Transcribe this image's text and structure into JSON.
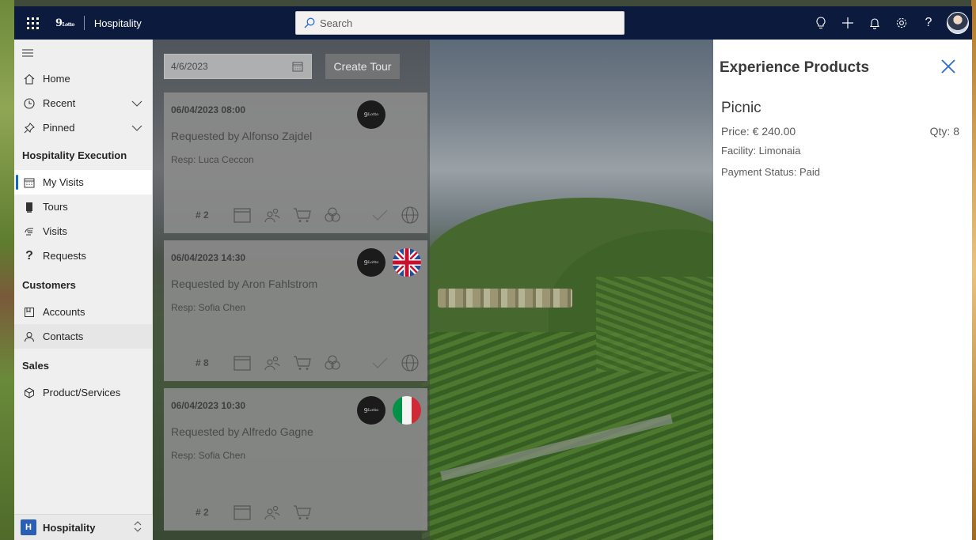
{
  "topbar": {
    "brand": "9",
    "brand_small": "Lotto",
    "app_name": "Hospitality",
    "search_placeholder": "Search",
    "icons": [
      "lightbulb-icon",
      "plus-icon",
      "bell-icon",
      "gear-icon",
      "help-icon"
    ],
    "help_label": "?"
  },
  "sidebar": {
    "home": "Home",
    "recent": "Recent",
    "pinned": "Pinned",
    "groups": {
      "execution": "Hospitality Execution",
      "customers": "Customers",
      "sales": "Sales"
    },
    "items": {
      "my_visits": "My Visits",
      "tours": "Tours",
      "visits": "Visits",
      "requests": "Requests",
      "accounts": "Accounts",
      "contacts": "Contacts",
      "product_services": "Product/Services"
    },
    "area": {
      "badge": "H",
      "label": "Hospitality"
    }
  },
  "toolbar": {
    "date_value": "4/6/2023",
    "create_tour_label": "Create Tour"
  },
  "cards": [
    {
      "datetime": "06/04/2023 08:00",
      "requested": "Requested by Alfonso Zajdel",
      "resp": "Resp: Luca Ceccon",
      "number": "# 2",
      "flag": "none"
    },
    {
      "datetime": "06/04/2023 14:30",
      "requested": "Requested by Aron Fahlstrom",
      "resp": "Resp: Sofia Chen",
      "number": "# 8",
      "flag": "uk"
    },
    {
      "datetime": "06/04/2023 10:30",
      "requested": "Requested by Alfredo Gagne",
      "resp": "Resp: Sofia Chen",
      "number": "# 2",
      "flag": "italy"
    }
  ],
  "panel": {
    "title": "Experience Products",
    "product_name": "Picnic",
    "price": "Price: € 240.00",
    "qty": "Qty: 8",
    "facility": "Facility: Limonaia",
    "payment": "Payment Status: Paid"
  },
  "colors": {
    "topbar": "#0c1a3d",
    "accent": "#0f6cbd",
    "close": "#2b6cd4"
  }
}
